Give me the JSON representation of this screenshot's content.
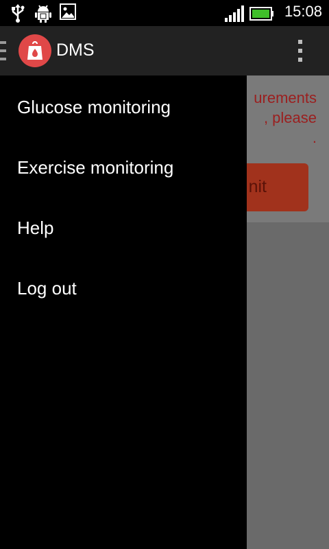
{
  "status_bar": {
    "time": "15:08",
    "icons": [
      "usb-icon",
      "android-debug-icon",
      "image-icon",
      "signal-icon",
      "battery-icon"
    ],
    "battery_color": "#3fbf2a"
  },
  "action_bar": {
    "title": "DMS",
    "logo_color": "#e04848",
    "icons": [
      "drawer-toggle-icon",
      "app-logo-icon",
      "overflow-menu-icon"
    ]
  },
  "drawer": {
    "items": [
      {
        "label": "Glucose monitoring"
      },
      {
        "label": "Exercise monitoring"
      },
      {
        "label": "Help"
      },
      {
        "label": "Log out"
      }
    ]
  },
  "background_content": {
    "message_lines": "urements\n, please\n.",
    "button_label": "nit",
    "message_color": "#9b1f1f",
    "button_color": "#a1321c"
  }
}
